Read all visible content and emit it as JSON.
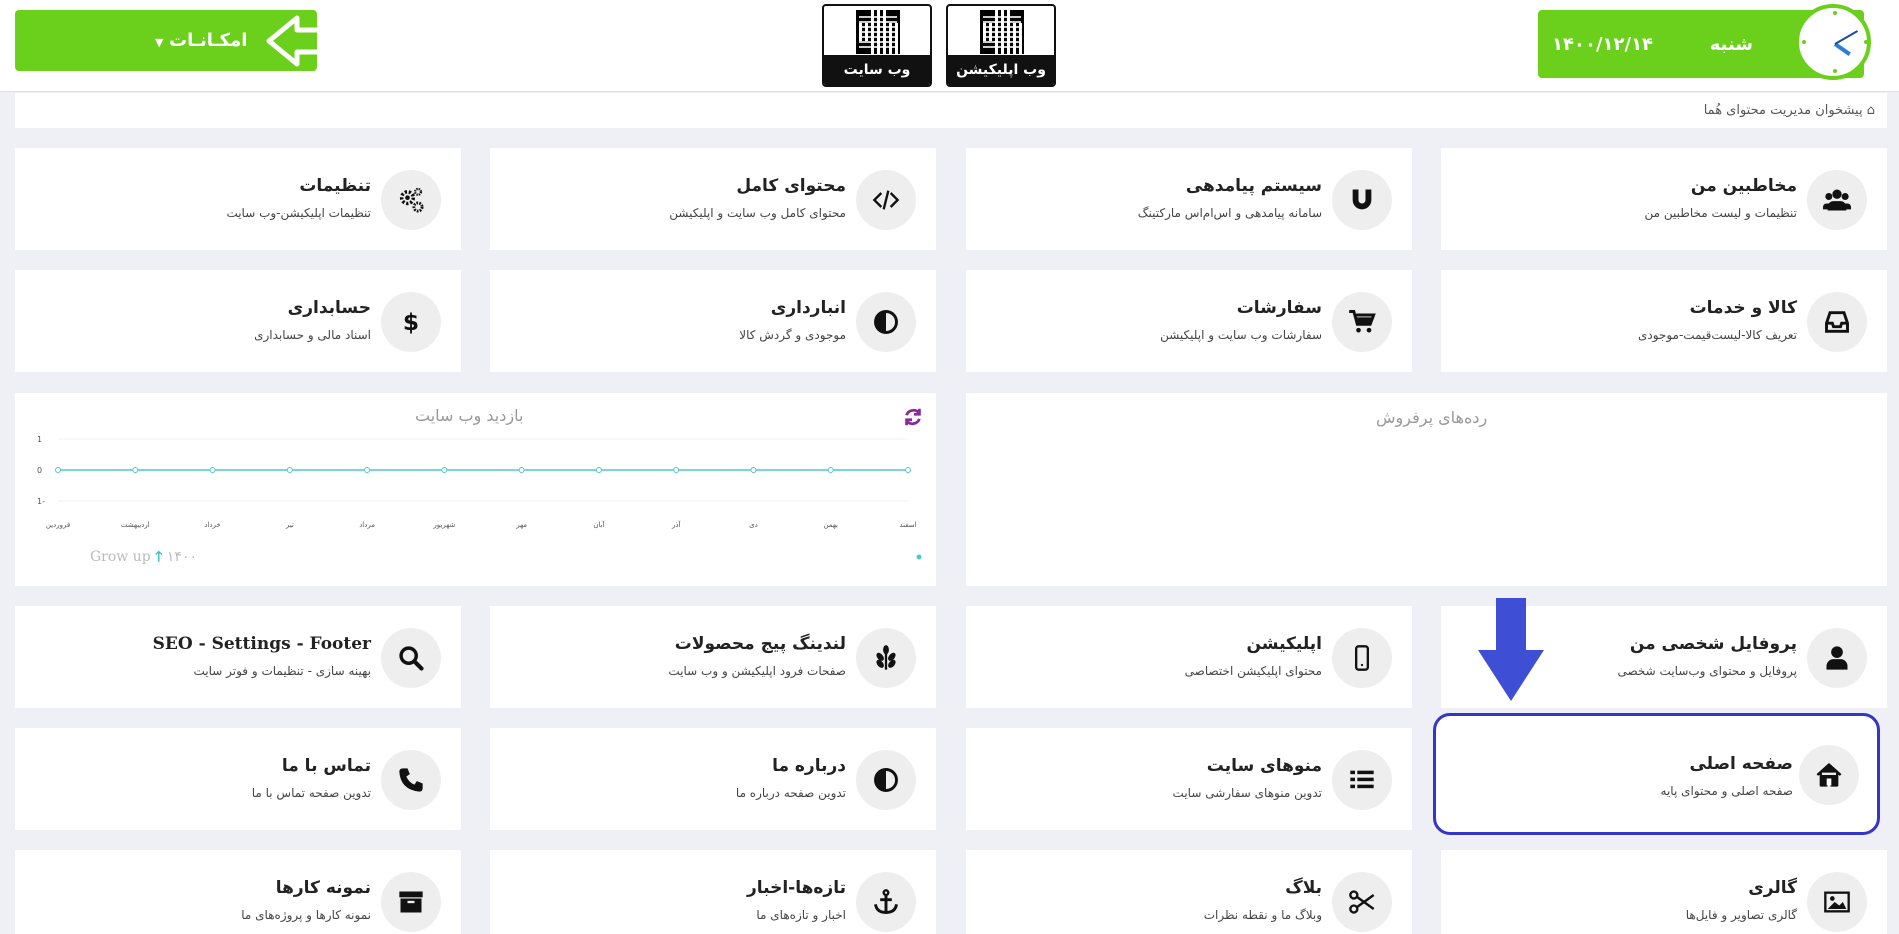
{
  "header": {
    "day": "شنبه",
    "date": "۱۴۰۰/۱۲/۱۴",
    "qr_app_label": "وب اپلیکیشن",
    "qr_site_label": "وب سایت",
    "menu_label": "امکـانـات"
  },
  "breadcrumb": "پیشخوان مدیریت محتوای هُما",
  "cards": [
    {
      "title": "مخاطبین من",
      "subtitle": "تنظیمات و لیست مخاطبین من",
      "icon": "users-icon"
    },
    {
      "title": "سیستم پیامدهی",
      "subtitle": "سامانه پیامدهی و اس‌ام‌اس مارکتینگ",
      "icon": "magnet-icon"
    },
    {
      "title": "محتوای کامل",
      "subtitle": "محتوای کامل وب سایت و اپلیکیشن",
      "icon": "code-icon"
    },
    {
      "title": "تنظیمات",
      "subtitle": "تنظیمات اپلیکیشن-وب سایت",
      "icon": "gears-icon"
    },
    {
      "title": "کالا و خدمات",
      "subtitle": "تعریف کالا-لیست‌قیمت-موجودی",
      "icon": "inbox-icon"
    },
    {
      "title": "سفارشات",
      "subtitle": "سفارشات وب سایت و اپلیکیشن",
      "icon": "cart-icon"
    },
    {
      "title": "انبارداری",
      "subtitle": "موجودی و گردش کالا",
      "icon": "contrast-icon"
    },
    {
      "title": "حسابداری",
      "subtitle": "اسناد مالی و حسابداری",
      "icon": "dollar-icon"
    },
    {
      "title": "پروفایل شخصی من",
      "subtitle": "پروفایل و محتوای وب‌سایت شخصی",
      "icon": "user-icon"
    },
    {
      "title": "اپلیکیشن",
      "subtitle": "محتوای اپلیکیشن اختصاصی",
      "icon": "mobile-icon"
    },
    {
      "title": "لندینگ پیج محصولات",
      "subtitle": "صفحات فرود اپلیکیشن و وب سایت",
      "icon": "leaf-icon"
    },
    {
      "title": "SEO - Settings - Footer",
      "subtitle": "بهینه سازی - تنظیمات و فوتر سایت",
      "icon": "search-icon"
    },
    {
      "title": "صفحه اصلی",
      "subtitle": "صفحه اصلی و محتوای پایه",
      "icon": "home-icon"
    },
    {
      "title": "منوهای سایت",
      "subtitle": "تدوین منوهای سفارشی سایت",
      "icon": "list-icon"
    },
    {
      "title": "درباره ما",
      "subtitle": "تدوین صفحه درباره ما",
      "icon": "contrast-icon"
    },
    {
      "title": "تماس با ما",
      "subtitle": "تدوین صفحه تماس با ما",
      "icon": "phone-icon"
    },
    {
      "title": "گالری",
      "subtitle": "گالری تصاویر و فایل‌ها",
      "icon": "image-icon"
    },
    {
      "title": "بلاگ",
      "subtitle": "وبلاگ ما و نقطه نظرات",
      "icon": "scissors-icon"
    },
    {
      "title": "تازه‌ها-اخبار",
      "subtitle": "اخبار و تازه‌های ما",
      "icon": "anchor-icon"
    },
    {
      "title": "نمونه کارها",
      "subtitle": "نمونه کارها و پروژه‌های ما",
      "icon": "archive-icon"
    }
  ],
  "bestsellers_title": "رده‌های پرفروش",
  "visits_title": "بازدید وب سایت",
  "growth": {
    "label": "Grow up",
    "year": "۱۴۰۰"
  },
  "colors": {
    "accent": "#6bd01c",
    "highlight": "#3535c7",
    "line": "#4fc9c9"
  },
  "chart_data": {
    "type": "line",
    "title": "بازدید وب سایت",
    "categories": [
      "اسفند",
      "بهمن",
      "دی",
      "آذر",
      "آبان",
      "مهر",
      "شهریور",
      "مرداد",
      "تیر",
      "خرداد",
      "اردیبهشت",
      "فروردین"
    ],
    "series": [
      {
        "values": [
          0,
          0,
          0,
          0,
          0,
          0,
          0,
          0,
          0,
          0,
          0,
          0
        ]
      }
    ],
    "ylim": [
      -1,
      1
    ],
    "yticks": [
      "1",
      "0",
      "1-"
    ]
  }
}
